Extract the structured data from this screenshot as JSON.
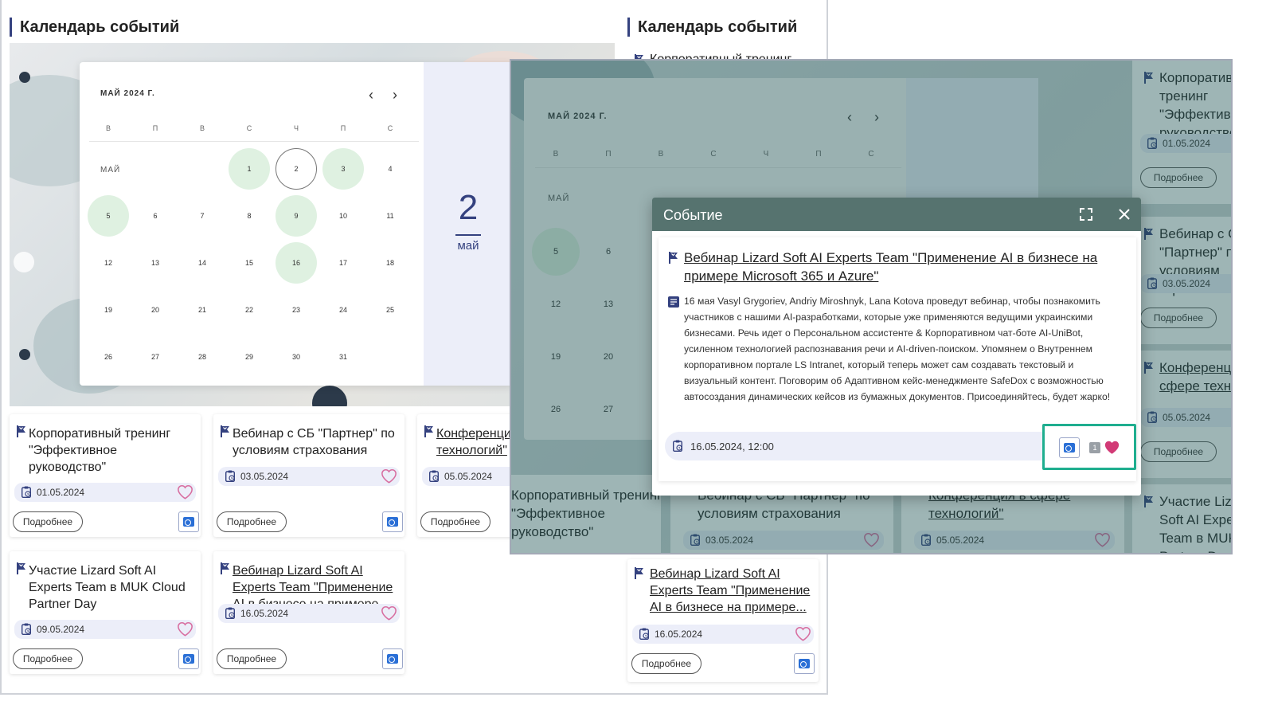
{
  "section_title": "Календарь событий",
  "calendar": {
    "month_label": "МАЙ 2024 Г.",
    "weekdays": [
      "В",
      "П",
      "В",
      "С",
      "Ч",
      "П",
      "С"
    ],
    "row_label": "МАЙ",
    "days": [
      "1",
      "2",
      "3",
      "4",
      "5",
      "6",
      "7",
      "8",
      "9",
      "10",
      "11",
      "12",
      "13",
      "14",
      "15",
      "16",
      "17",
      "18",
      "19",
      "20",
      "21",
      "22",
      "23",
      "24",
      "25",
      "26",
      "27",
      "28",
      "29",
      "30",
      "31"
    ],
    "selected_day": "2",
    "selected_month": "май",
    "event_days": [
      "1",
      "3",
      "5",
      "9",
      "16"
    ]
  },
  "more_label": "Подробнее",
  "events": [
    {
      "title": "Корпоративный тренинг \"Эффективное руководство\"",
      "date": "01.05.2024"
    },
    {
      "title": "Вебинар с СБ \"Партнер\" по условиям страхования",
      "date": "03.05.2024"
    },
    {
      "title": "Конференция в сфере технологий\"",
      "date": "05.05.2024"
    },
    {
      "title": "Участие Lizard Soft AI Experts Team в MUK Cloud Partner Day",
      "date": "09.05.2024"
    },
    {
      "title": "Вебинар Lizard Soft AI Experts Team \"Применение AI в бизнесе на примере...",
      "date": "16.05.2024"
    }
  ],
  "right_col": {
    "first_title_clip": "Корпоративный тренинг",
    "bottom_title": "Вебинар Lizard Soft AI Experts Team \"Применение AI в бизнесе на примере...",
    "bottom_date": "16.05.2024"
  },
  "overlay": {
    "right_cards": [
      {
        "title": "Корпоративный тренинг \"Эффективное руководство\"",
        "date": "01.05.2024"
      },
      {
        "title": "Вебинар с СБ \"Партнер\" по условиям страхования",
        "date": "03.05.2024"
      },
      {
        "title": "Конференция в сфере технологий\"",
        "date": "05.05.2024"
      },
      {
        "title": "Участие Lizard Soft AI Experts Team в MUK Cloud Partner Day",
        "date": ""
      }
    ],
    "bottom_cards": [
      {
        "title": "Корпоративный тренинг \"Эффективное руководство\"",
        "date": ""
      },
      {
        "title": "Вебинар с СБ \"Партнер\" по условиям страхования",
        "date": "03.05.2024"
      },
      {
        "title": "Конференция в сфере технологий\"",
        "date": "05.05.2024"
      }
    ],
    "cal_rows": [
      [
        "5",
        "6"
      ],
      [
        "12",
        "13"
      ],
      [
        "19",
        "20"
      ],
      [
        "26",
        "27"
      ]
    ]
  },
  "modal": {
    "header": "Событие",
    "title": "Вебинар Lizard Soft AI Experts Team \"Применение AI в бизнесе на примере Microsoft 365 и Azure\"",
    "description": "16 мая Vasyl Grygoriev, Andriy Miroshnyk, Lana Kotova проведут вебинар, чтобы познакомить участников с нашими AI-разработками, которые уже применяются ведущими украинскими бизнесами. Речь идет о Персональном ассистенте & Корпоративном чат-боте AI-UniBot, усиленном технологией распознавания речи и AI-driven-поиском. Упомянем о Внутреннем корпоративном портале LS Intranet, который теперь может сам создавать текстовый и визуальный контент. Поговорим об Адаптивном кейс-менеджменте SafeDox с возможностью автосоздания динамических кейсов из бумажных документов. Присоединяйтесь, будет жарко!",
    "datetime": "16.05.2024, 12:00",
    "like_count": "1"
  },
  "colors": {
    "accent": "#34417f",
    "event_day": "#dff1e1",
    "highlight": "#1fae8f",
    "heart": "#d23a76"
  }
}
